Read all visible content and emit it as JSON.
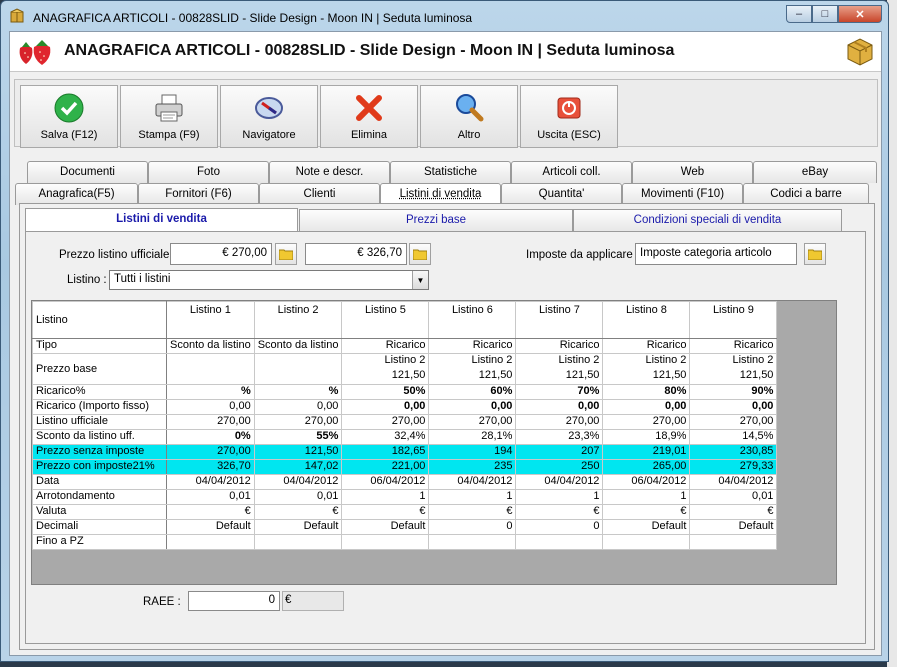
{
  "window": {
    "title": "ANAGRAFICA ARTICOLI - 00828SLID - Slide Design - Moon IN | Seduta luminosa",
    "minimize": "–",
    "maximize": "□",
    "close": "✕"
  },
  "header": {
    "title": "ANAGRAFICA ARTICOLI - 00828SLID - Slide Design - Moon IN | Seduta luminosa"
  },
  "toolbar": {
    "buttons": [
      {
        "label": "Salva (F12)",
        "icon": "check-icon"
      },
      {
        "label": "Stampa (F9)",
        "icon": "printer-icon"
      },
      {
        "label": "Navigatore",
        "icon": "compass-icon"
      },
      {
        "label": "Elimina",
        "icon": "delete-icon"
      },
      {
        "label": "Altro",
        "icon": "search-icon"
      },
      {
        "label": "Uscita (ESC)",
        "icon": "exit-icon"
      }
    ]
  },
  "tabs_top": [
    "Documenti",
    "Foto",
    "Note e descr.",
    "Statistiche",
    "Articoli coll.",
    "Web",
    "eBay"
  ],
  "tabs_bottom": [
    "Anagrafica(F5)",
    "Fornitori (F6)",
    "Clienti",
    "Listini di vendita",
    "Quantita'",
    "Movimenti (F10)",
    "Codici a barre"
  ],
  "subtabs": [
    "Listini di vendita",
    "Prezzi base",
    "Condizioni speciali di vendita"
  ],
  "form": {
    "prezzo_label": "Prezzo listino ufficiale :",
    "prezzo_value1": "€ 270,00",
    "prezzo_value2": "€ 326,70",
    "imposte_label": "Imposte da applicare :",
    "imposte_value": "Imposte categoria articolo",
    "listino_label": "Listino :",
    "listino_value": "Tutti i listini"
  },
  "grid": {
    "corner": "Listino",
    "columns": [
      "Listino 1",
      "Listino 2",
      "Listino 5",
      "Listino 6",
      "Listino 7",
      "Listino 8",
      "Listino 9"
    ],
    "rows": [
      {
        "label": "Tipo",
        "cells": [
          "Sconto da listino",
          "Sconto da listino",
          "Ricarico",
          "Ricarico",
          "Ricarico",
          "Ricarico",
          "Ricarico"
        ]
      },
      {
        "label": "Prezzo base",
        "cells": [
          [
            "",
            ""
          ],
          [
            "",
            ""
          ],
          [
            "Listino 2",
            "121,50"
          ],
          [
            "Listino 2",
            "121,50"
          ],
          [
            "Listino 2",
            "121,50"
          ],
          [
            "Listino 2",
            "121,50"
          ],
          [
            "Listino 2",
            "121,50"
          ]
        ]
      },
      {
        "label": "Ricarico%",
        "cells": [
          "%",
          "%",
          "50%",
          "60%",
          "70%",
          "80%",
          "90%"
        ]
      },
      {
        "label": "Ricarico (Importo fisso)",
        "cells": [
          "0,00",
          "0,00",
          "0,00",
          "0,00",
          "0,00",
          "0,00",
          "0,00"
        ]
      },
      {
        "label": "Listino ufficiale",
        "cells": [
          "270,00",
          "270,00",
          "270,00",
          "270,00",
          "270,00",
          "270,00",
          "270,00"
        ]
      },
      {
        "label": "Sconto da listino uff.",
        "cells": [
          "0%",
          "55%",
          "32,4%",
          "28,1%",
          "23,3%",
          "18,9%",
          "14,5%"
        ]
      },
      {
        "label": "Prezzo senza imposte",
        "cells": [
          "270,00",
          "121,50",
          "182,65",
          "194",
          "207",
          "219,01",
          "230,85"
        ]
      },
      {
        "label": "Prezzo con imposte21%",
        "cells": [
          "326,70",
          "147,02",
          "221,00",
          "235",
          "250",
          "265,00",
          "279,33"
        ]
      },
      {
        "label": "Data",
        "cells": [
          "04/04/2012",
          "04/04/2012",
          "06/04/2012",
          "04/04/2012",
          "04/04/2012",
          "06/04/2012",
          "04/04/2012"
        ]
      },
      {
        "label": "Arrotondamento",
        "cells": [
          "0,01",
          "0,01",
          "1",
          "1",
          "1",
          "1",
          "0,01"
        ]
      },
      {
        "label": "Valuta",
        "cells": [
          "€",
          "€",
          "€",
          "€",
          "€",
          "€",
          "€"
        ]
      },
      {
        "label": "Decimali",
        "cells": [
          "Default",
          "Default",
          "Default",
          "0",
          "0",
          "Default",
          "Default"
        ]
      },
      {
        "label": "Fino a PZ",
        "cells": [
          "",
          "",
          "",
          "",
          "",
          "",
          ""
        ]
      }
    ]
  },
  "raee": {
    "label": "RAEE :",
    "value": "0",
    "unit": "€"
  },
  "colors": {
    "highlight_row": "#00e6f0",
    "subtab_text": "#1a1aaa"
  }
}
